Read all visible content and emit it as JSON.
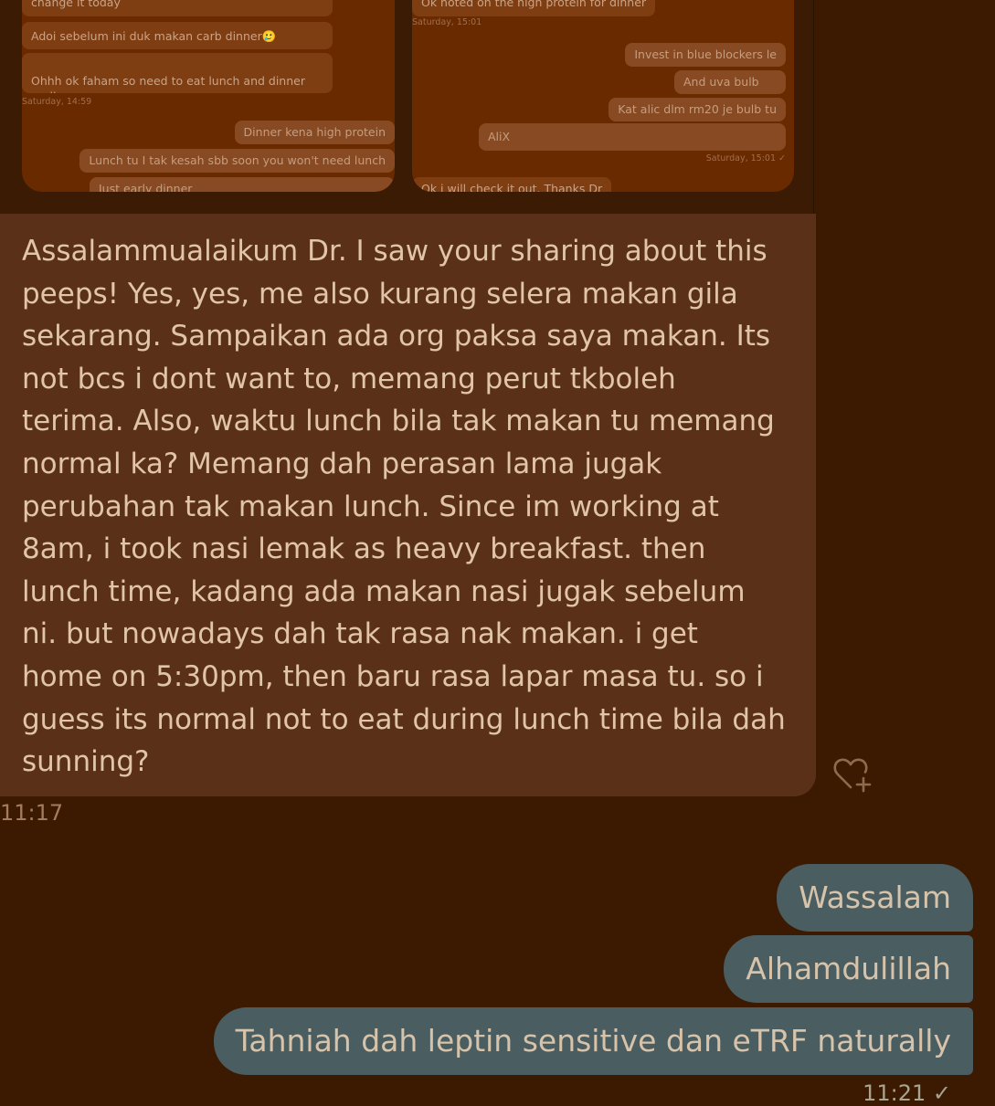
{
  "embedded_screenshot": {
    "left_chat": {
      "incoming": [
        "change it today",
        "Adoi sebelum ini duk makan carb dinner🥲",
        "Ohhh ok faham so need to eat lunch and dinner\nearlier"
      ],
      "timestamp": "Saturday, 14:59",
      "outgoing": [
        "Dinner kena high protein",
        "Lunch tu I tak kesah sbb soon you won't need lunch",
        "Just early dinner"
      ]
    },
    "right_chat": {
      "incoming_top": "Ok noted on the high protein for dinner",
      "timestamp_top": "Saturday, 15:01",
      "outgoing": [
        "Invest in blue blockers le",
        "And uva bulb",
        "Kat alic dlm rm20 je bulb tu",
        "AliX"
      ],
      "timestamp_outgoing": "Saturday, 15:01 ✓",
      "incoming_bottom": "Ok i will check it out. Thanks Dr"
    }
  },
  "incoming_message": {
    "text": "Assalammualaikum Dr. I saw your sharing about this\npeeps! Yes, yes, me also kurang selera makan gila\nsekarang. Sampaikan ada org paksa saya makan. Its\nnot bcs i dont want to, memang perut tkboleh\nterima. Also, waktu lunch bila tak makan tu memang\nnormal ka? Memang dah perasan lama jugak\nperubahan tak makan lunch. Since im working at\n8am, i took nasi lemak as heavy breakfast. then\nlunch time, kadang ada makan nasi jugak sebelum\nni. but nowadays dah tak rasa nak makan. i get\nhome on 5:30pm, then baru rasa lapar masa tu. so i\nguess its normal not to eat during lunch time bila dah\nsunning?",
    "time": "11:17",
    "react_icon": "heart-plus-icon"
  },
  "outgoing_messages": [
    "Wassalam",
    "Alhamdulillah",
    "Tahniah dah leptin sensitive dan eTRF naturally"
  ],
  "outgoing_time": "11:21 ✓",
  "colors": {
    "background": "#3c1a02",
    "incoming_bubble": "#5b3019",
    "outgoing_bubble": "#4a5d60",
    "embed_panel": "#6a2a00"
  }
}
